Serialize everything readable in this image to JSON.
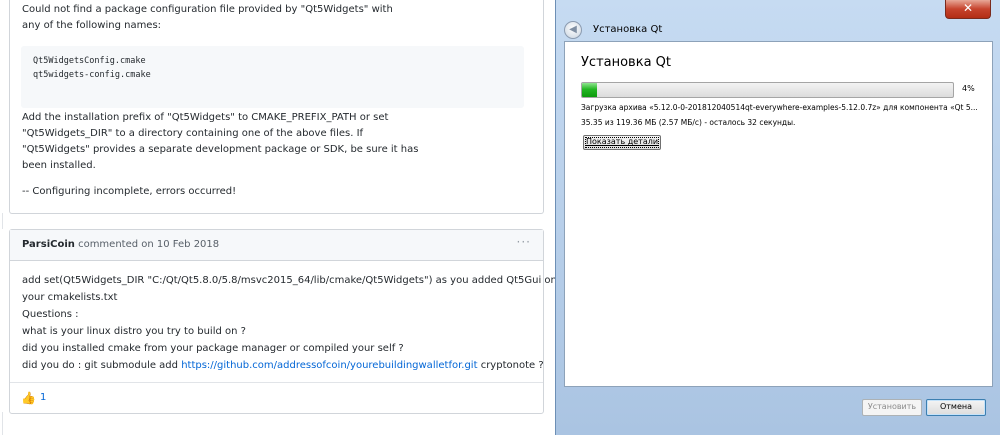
{
  "comment1": {
    "lines_top": [
      "Could not find a package configuration file provided by \"Qt5Widgets\" with",
      "any of the following names:"
    ],
    "code": "Qt5WidgetsConfig.cmake\nqt5widgets-config.cmake",
    "lines_bottom": [
      "Add the installation prefix of \"Qt5Widgets\" to CMAKE_PREFIX_PATH or set",
      "\"Qt5Widgets_DIR\" to a directory containing one of the above files. If",
      "\"Qt5Widgets\" provides a separate development package or SDK, be sure it has",
      "been installed."
    ],
    "footer_line": "-- Configuring incomplete, errors occurred!"
  },
  "comment2": {
    "author": "ParsiCoin",
    "meta": "commented on 10 Feb 2018",
    "menu": "···",
    "body": [
      "add set(Qt5Widgets_DIR \"C:/Qt/Qt5.8.0/5.8/msvc2015_64/lib/cmake/Qt5Widgets\") as you added Qt5Gui on",
      "your cmakelists.txt",
      "Questions :",
      "what is your linux distro you try to build on ?",
      "did you installed cmake from your package manager or compiled your self ?"
    ],
    "last_line_prefix": "did you do : git submodule add ",
    "link": "https://github.com/addressofcoin/yourebuildingwalletfor.git",
    "last_line_suffix": " cryptonote ?",
    "reaction_emoji": "👍",
    "reaction_count": "1"
  },
  "installer": {
    "close_glyph": "✕",
    "back_glyph": "◀",
    "window_title": "Установка Qt",
    "heading": "Установка Qt",
    "progress": 0.04,
    "progress_label": "4%",
    "status_line": "Загрузка архива «5.12.0-0-201812040514qt-everywhere-examples-5.12.0.7z» для компонента «Qt 5...",
    "size_line": "35.35 из 119.36 МБ (2.57 МБ/c) - осталось 32 секунды.",
    "details_button": "Показать детали",
    "install_button": "Установить",
    "cancel_button": "Отмена",
    "colors": {
      "progress_fill": "#23b623",
      "window_frame": "#b9d1ea"
    }
  }
}
